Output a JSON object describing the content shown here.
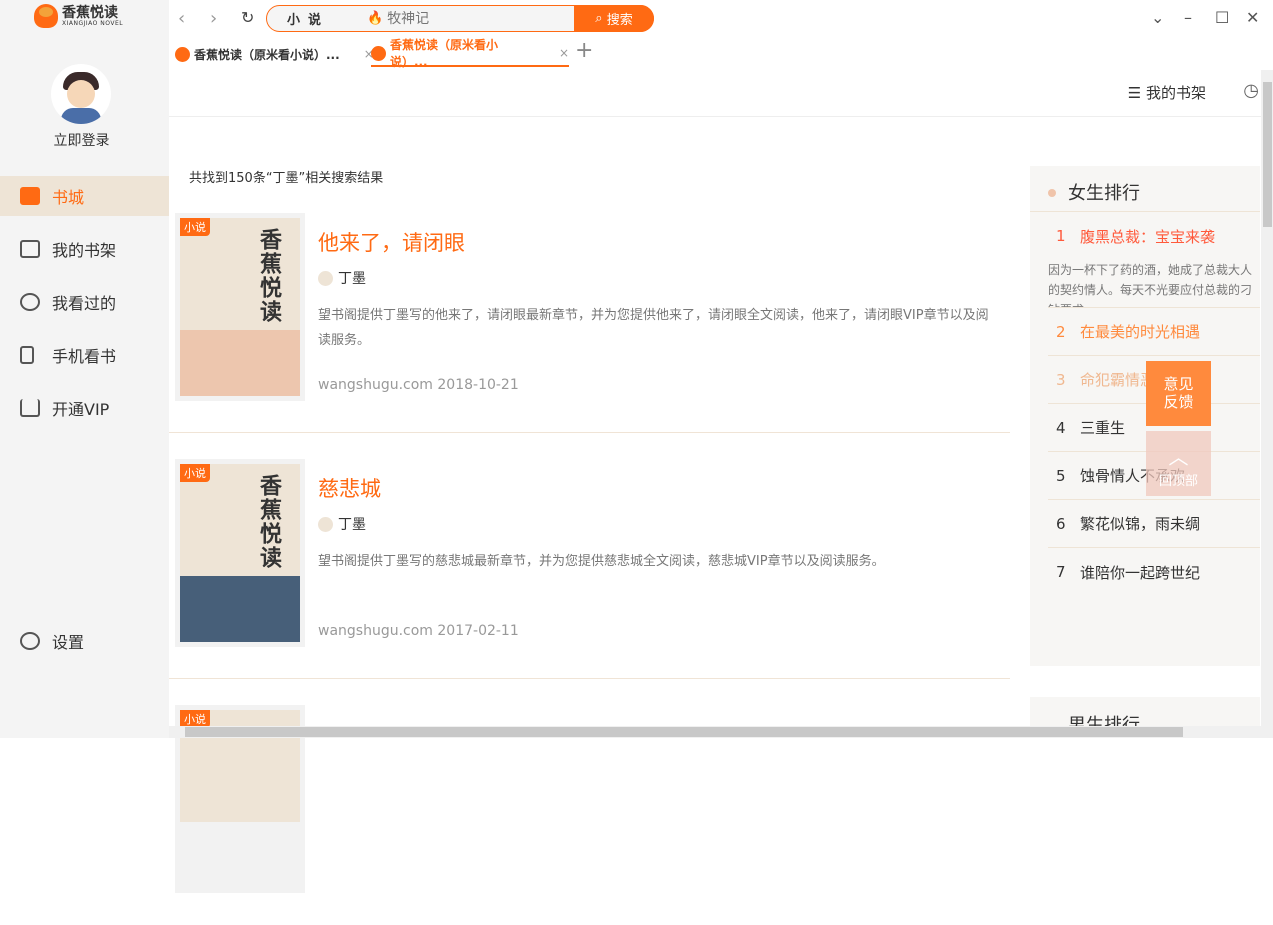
{
  "app": {
    "logo_title": "香蕉悦读",
    "logo_sub": "XIANGJIAO NOVEL"
  },
  "sidebar": {
    "login": "立即登录",
    "items": [
      {
        "label": "书城"
      },
      {
        "label": "我的书架"
      },
      {
        "label": "我看过的"
      },
      {
        "label": "手机看书"
      },
      {
        "label": "开通VIP"
      }
    ],
    "settings": "设置"
  },
  "search": {
    "category": "小说",
    "placeholder": "牧神记",
    "button": "搜索"
  },
  "tabs": [
    {
      "label": "香蕉悦读（原米看小说）..."
    },
    {
      "label": "香蕉悦读（原米看小说）..."
    }
  ],
  "header": {
    "shelf": "我的书架"
  },
  "results": {
    "summary": "共找到150条“丁墨”相关搜索结果",
    "books": [
      {
        "badge": "小说",
        "cover_text": "香蕉悦读",
        "title": "他来了，请闭眼",
        "author": "丁墨",
        "desc": "望书阁提供丁墨写的他来了，请闭眼最新章节，并为您提供他来了，请闭眼全文阅读，他来了，请闭眼VIP章节以及阅读服务。",
        "source": "wangshugu.com 2018-10-21",
        "cover_color": "#edc6ae"
      },
      {
        "badge": "小说",
        "cover_text": "香蕉悦读",
        "title": "慈悲城",
        "author": "丁墨",
        "desc": "望书阁提供丁墨写的慈悲城最新章节，并为您提供慈悲城全文阅读，慈悲城VIP章节以及阅读服务。",
        "source": "wangshugu.com 2017-02-11",
        "cover_color": "#475f79"
      },
      {
        "badge": "小说"
      }
    ]
  },
  "ranking": {
    "title": "女生排行",
    "top_desc": "因为一杯下了药的酒，她成了总裁大人的契约情人。每天不光要应付总裁的刁钻要求",
    "items": [
      {
        "n": "1",
        "title": "腹黑总裁：宝宝来袭",
        "color": "#ff5a3c"
      },
      {
        "n": "2",
        "title": "在最美的时光相遇",
        "color": "#ff8a3d"
      },
      {
        "n": "3",
        "title": "命犯霸情恶少",
        "color": "#f0b890"
      },
      {
        "n": "4",
        "title": "三重生"
      },
      {
        "n": "5",
        "title": "蚀骨情人不承欢"
      },
      {
        "n": "6",
        "title": "繁花似锦，雨未绸"
      },
      {
        "n": "7",
        "title": "谁陪你一起跨世纪"
      }
    ],
    "title2": "男生排行"
  },
  "float": {
    "feedback": "意见反馈",
    "top": "回顶部"
  }
}
